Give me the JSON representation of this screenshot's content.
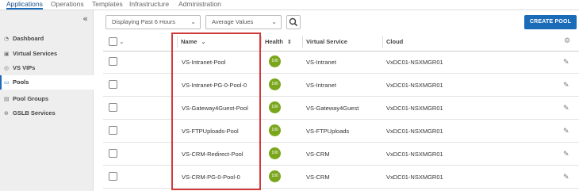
{
  "topnav": {
    "tabs": [
      {
        "label": "Applications",
        "active": true
      },
      {
        "label": "Operations",
        "active": false
      },
      {
        "label": "Templates",
        "active": false
      },
      {
        "label": "Infrastructure",
        "active": false
      },
      {
        "label": "Administration",
        "active": false
      }
    ]
  },
  "sidebar": {
    "collapse_icon": "double-chevron-left-icon",
    "items": [
      {
        "label": "Dashboard",
        "icon": "dashboard-icon",
        "active": false
      },
      {
        "label": "Virtual Services",
        "icon": "virtual-services-icon",
        "active": false
      },
      {
        "label": "VS VIPs",
        "icon": "location-pin-icon",
        "active": false
      },
      {
        "label": "Pools",
        "icon": "pool-icon",
        "active": true
      },
      {
        "label": "Pool Groups",
        "icon": "pool-group-icon",
        "active": false
      },
      {
        "label": "GSLB Services",
        "icon": "globe-icon",
        "active": false
      }
    ]
  },
  "toolbar": {
    "time_range": "Displaying Past 6 Hours",
    "metric": "Average Values",
    "create_label": "CREATE POOL"
  },
  "table": {
    "columns": {
      "name": "Name",
      "name_sort": "⌄",
      "health": "Health",
      "health_sort": "⇕",
      "virtual_service": "Virtual Service",
      "cloud": "Cloud"
    },
    "rows": [
      {
        "name": "VS-Intranet-Pool",
        "health": "100",
        "virtual_service": "VS-Intranet",
        "cloud": "VxDC01-NSXMGR01"
      },
      {
        "name": "VS-Intranet-PG-0-Pool-0",
        "health": "100",
        "virtual_service": "VS-Intranet",
        "cloud": "VxDC01-NSXMGR01"
      },
      {
        "name": "VS-Gateway4Guest-Pool",
        "health": "100",
        "virtual_service": "VS-Gateway4Guest",
        "cloud": "VxDC01-NSXMGR01"
      },
      {
        "name": "VS-FTPUploads-Pool",
        "health": "100",
        "virtual_service": "VS-FTPUploads",
        "cloud": "VxDC01-NSXMGR01"
      },
      {
        "name": "VS-CRM-Redirect-Pool",
        "health": "100",
        "virtual_service": "VS-CRM",
        "cloud": "VxDC01-NSXMGR01"
      },
      {
        "name": "VS-CRM-PG-0-Pool-0",
        "health": "100",
        "virtual_service": "VS-CRM",
        "cloud": "VxDC01-NSXMGR01"
      }
    ]
  },
  "colors": {
    "accent": "#1a6bb8",
    "health_good": "#7aa61b",
    "highlight": "#d23a3a"
  }
}
